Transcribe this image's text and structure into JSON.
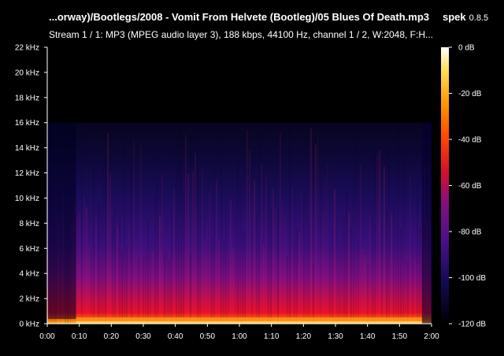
{
  "header": {
    "title": "...orway)/Bootlegs/2008 - Vomit From Helvete (Bootleg)/05 Blues Of Death.mp3",
    "app_name": "spek",
    "app_version": "0.8.5",
    "stream_info": "Stream 1 / 1: MP3 (MPEG audio layer 3), 188 kbps, 44100 Hz, channel 1 / 2, W:2048, F:H..."
  },
  "colors": {
    "background": "#000000",
    "text": "#ffffff",
    "palette": [
      "#000000",
      "#0a0630",
      "#1a0d6e",
      "#4b0f8a",
      "#8a0f7a",
      "#d4102a",
      "#ff4a00",
      "#ff9a00",
      "#ffe060",
      "#ffffff"
    ]
  },
  "chart_data": {
    "type": "heatmap",
    "title": "",
    "xlabel": "",
    "ylabel": "",
    "x_ticks": [
      "0:00",
      "0:10",
      "0:20",
      "0:30",
      "0:40",
      "0:50",
      "1:00",
      "1:10",
      "1:20",
      "1:30",
      "1:40",
      "1:50",
      "2:00"
    ],
    "y_ticks": [
      "0 kHz",
      "2 kHz",
      "4 kHz",
      "6 kHz",
      "8 kHz",
      "10 kHz",
      "12 kHz",
      "14 kHz",
      "16 kHz",
      "18 kHz",
      "20 kHz",
      "22 kHz"
    ],
    "xlim_seconds": [
      0,
      120
    ],
    "ylim_khz": [
      0,
      22
    ],
    "frequency_cutoff_khz": 16,
    "colorbar": {
      "labels": [
        "0 dB",
        "-20 dB",
        "-40 dB",
        "-60 dB",
        "-80 dB",
        "-100 dB",
        "-120 dB"
      ],
      "range_db": [
        -120,
        0
      ]
    }
  }
}
